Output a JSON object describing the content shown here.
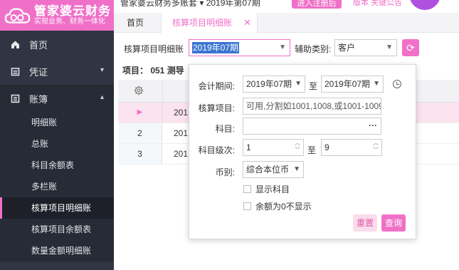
{
  "app": {
    "logo_title": "管家婆云财务",
    "logo_sub": "实现业务、财务一体化",
    "company": "管家婆云财务多账套 ▾ 2019年第07期",
    "trial_button": "进入注册后",
    "extra_text": "版本  关键公告"
  },
  "sidebar": {
    "items": [
      {
        "label": "首页",
        "icon": "home-icon"
      },
      {
        "label": "凭证",
        "icon": "voucher-icon",
        "caret": "▾"
      },
      {
        "label": "账簿",
        "icon": "book-icon",
        "caret": "▴"
      }
    ],
    "sub_items": [
      "明细账",
      "总账",
      "科目余额表",
      "多栏账",
      "核算项目明细账",
      "核算项目余额表",
      "数量金额明细账"
    ],
    "active_sub": "核算项目明细账"
  },
  "tabs": [
    {
      "label": "首页"
    },
    {
      "label": "核算项目明细账",
      "close": "✕"
    }
  ],
  "toolbar": {
    "report_label": "核算项目明细账",
    "period_value": "2019年07期",
    "aux_label": "辅助类别:",
    "aux_value": "客户",
    "refresh_icon": "⟳"
  },
  "info": {
    "text": "项目： 051 测导"
  },
  "grid": {
    "rows": [
      {
        "idx": "▶",
        "cell": "201"
      },
      {
        "idx": "2",
        "cell": "201"
      },
      {
        "idx": "3",
        "cell": "201"
      }
    ]
  },
  "popup": {
    "period_label": "会计期间:",
    "period_from": "2019年07期",
    "to_text": "至",
    "period_to": "2019年07期",
    "item_label": "核算项目:",
    "item_placeholder": "可用,分割如1001,1008,或1001-1009",
    "subject_label": "科目:",
    "subject_value": "",
    "level_label": "科目级次:",
    "level_from": "1",
    "level_to": "9",
    "currency_label": "币别:",
    "currency_value": "综合本位币",
    "show_subject": "显示科目",
    "hide_zero": "余额为0不显示",
    "reset": "重置",
    "query": "查询"
  },
  "colors": {
    "accent": "#f070c8",
    "sidebar": "#2f3542"
  }
}
